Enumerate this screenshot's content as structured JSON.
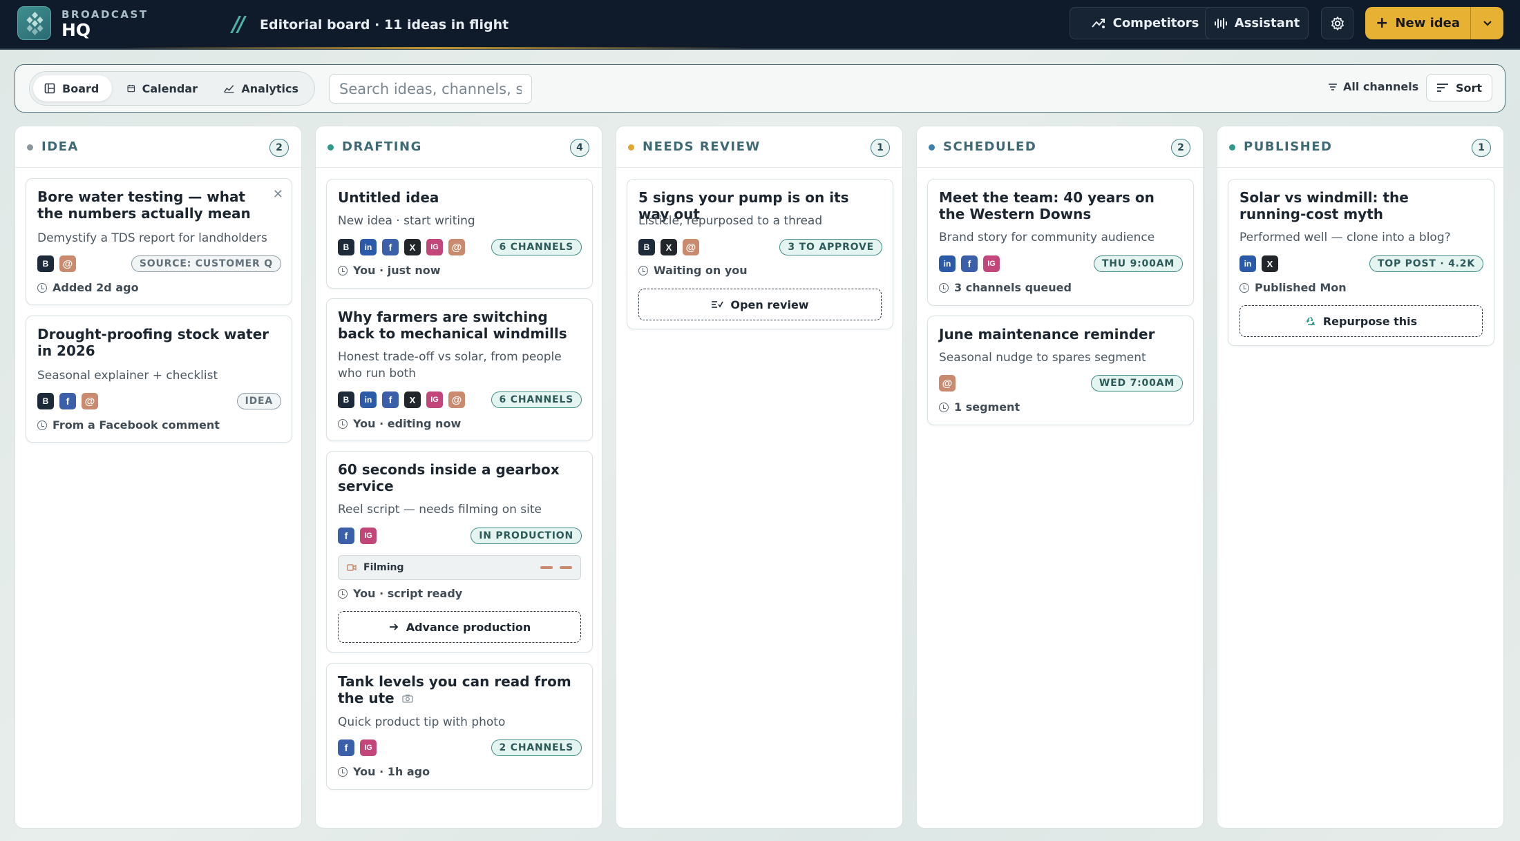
{
  "header": {
    "brand_top": "BROADCAST",
    "brand_main": "HQ",
    "slashes": "//",
    "board_title": "Editorial board · 11 ideas in flight",
    "competitors_label": "Competitors",
    "assistant_label": "Assistant",
    "new_idea_label": "New idea"
  },
  "toolbar": {
    "tabs": [
      {
        "label": "Board",
        "icon": "board-icon",
        "active": true
      },
      {
        "label": "Calendar",
        "icon": "calendar-icon",
        "active": false
      },
      {
        "label": "Analytics",
        "icon": "analytics-icon",
        "active": false
      }
    ],
    "search_placeholder": "Search ideas, channels, se",
    "all_channels_label": "All channels",
    "sort_label": "Sort"
  },
  "columns": [
    {
      "title": "IDEA",
      "count": "2",
      "dot_color": "#8a969e",
      "cards": [
        {
          "title": "Bore water testing — what the numbers actually mean",
          "sub": "Demystify a TDS report for landholders",
          "chips": [
            "B",
            "@"
          ],
          "pill": "SOURCE: CUSTOMER Q",
          "meta": "Added 2d ago"
        },
        {
          "title": "Drought-proofing stock water in 2026",
          "sub": "Seasonal explainer + checklist",
          "chips": [
            "B",
            "f",
            "@"
          ],
          "pill": "IDEA",
          "meta": "From a Facebook comment"
        }
      ]
    },
    {
      "title": "DRAFTING",
      "count": "4",
      "dot_color": "#2f9a8a",
      "cards": [
        {
          "title": "Untitled idea",
          "sub": "New idea · start writing",
          "chips": [
            "B",
            "in",
            "f",
            "X",
            "IG",
            "@"
          ],
          "pill": "6 CHANNELS",
          "meta": "You · just now"
        },
        {
          "title": "Why farmers are switching back to mechanical windmills",
          "sub": "Honest trade-off vs solar, from people",
          "sub2": "who run both",
          "chips": [
            "B",
            "in",
            "f",
            "X",
            "IG",
            "@"
          ],
          "pill": "6 CHANNELS",
          "meta": "You · editing now"
        },
        {
          "title": "60 seconds inside a gearbox service",
          "sub": "Reel script — needs filming on site",
          "chips": [
            "f",
            "IG"
          ],
          "pill": "IN PRODUCTION",
          "filming": "Filming",
          "meta": "You · script ready",
          "action": "Advance production"
        },
        {
          "title": "Tank levels you can read from the ute",
          "sub": "Quick product tip with photo",
          "chips": [
            "f",
            "IG"
          ],
          "pill": "2 CHANNELS",
          "meta": "You · 1h ago"
        }
      ]
    },
    {
      "title": "NEEDS REVIEW",
      "count": "1",
      "dot_color": "#e0a630",
      "cards": [
        {
          "title": "5 signs your pump is on its way out",
          "sub": "Listicle, repurposed to a thread",
          "chips": [
            "B",
            "X",
            "@"
          ],
          "pill": "3 TO APPROVE",
          "meta": "Waiting on you",
          "action": "Open review"
        }
      ]
    },
    {
      "title": "SCHEDULED",
      "count": "2",
      "dot_color": "#3d7fb0",
      "cards": [
        {
          "title": "Meet the team: 40 years on the Western Downs",
          "sub": "Brand story for community audience",
          "chips": [
            "in",
            "f",
            "IG"
          ],
          "pill": "THU 9:00AM",
          "meta": "3 channels queued"
        },
        {
          "title": "June maintenance reminder",
          "sub": "Seasonal nudge to spares segment",
          "chips": [
            "@"
          ],
          "pill": "WED 7:00AM",
          "meta": "1 segment"
        }
      ]
    },
    {
      "title": "PUBLISHED",
      "count": "1",
      "dot_color": "#2f9a8a",
      "cards": [
        {
          "title": "Solar vs windmill: the running-cost myth",
          "sub": "Performed well — clone into a blog?",
          "chips": [
            "in",
            "X"
          ],
          "pill": "TOP POST · 4.2K",
          "meta": "Published Mon",
          "action": "Repurpose this"
        }
      ]
    }
  ]
}
